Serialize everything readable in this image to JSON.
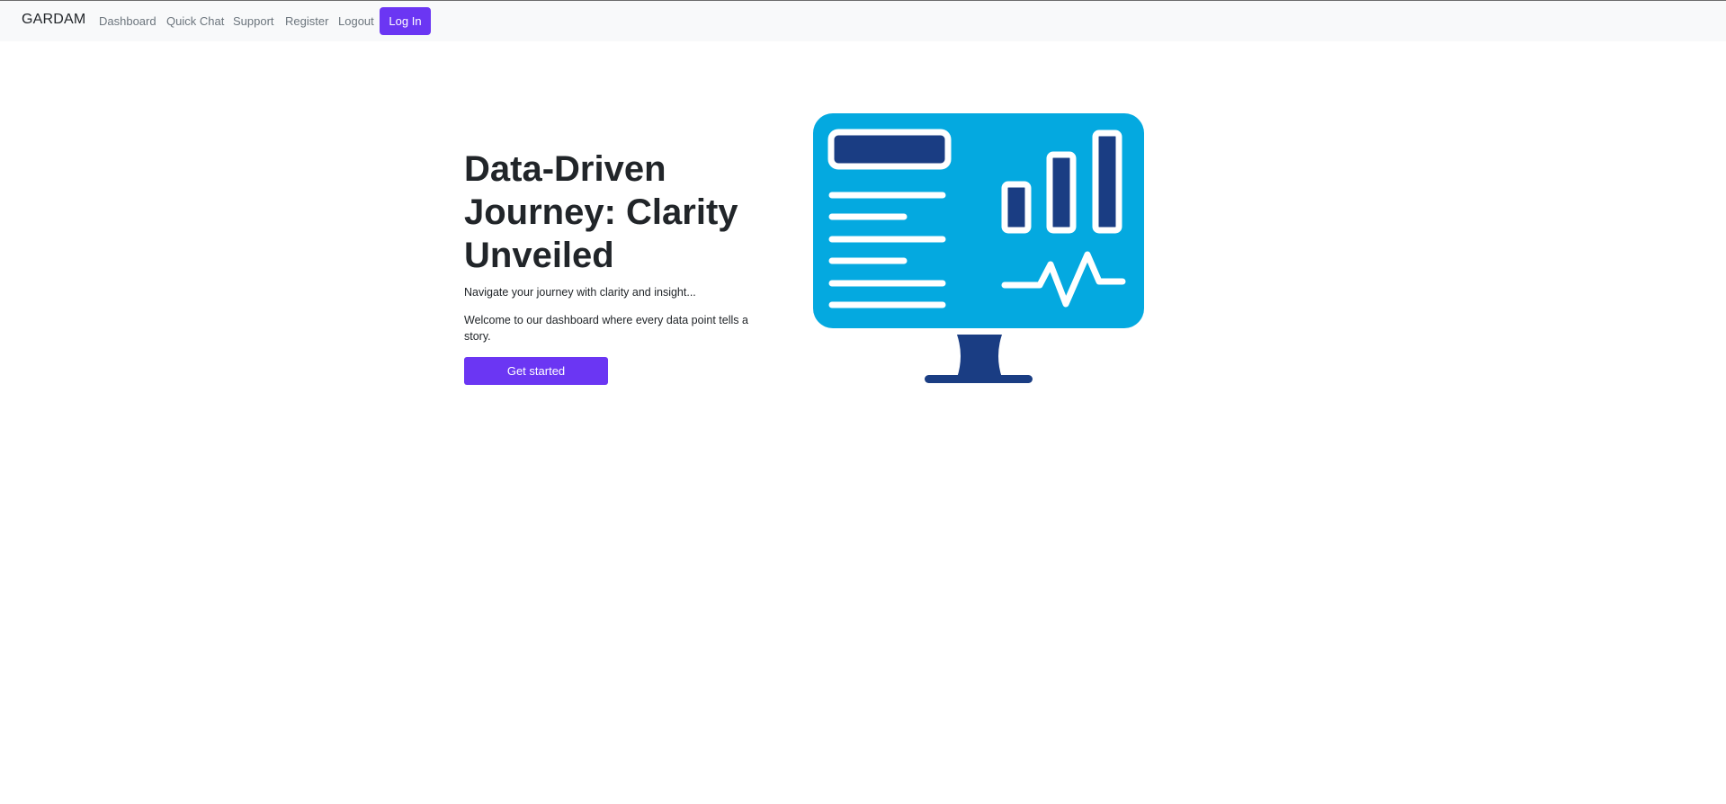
{
  "navbar": {
    "brand": "GARDAM",
    "links": [
      {
        "label": "Dashboard"
      },
      {
        "label": "Quick Chat"
      },
      {
        "label": "Support"
      },
      {
        "label": "Register"
      },
      {
        "label": "Logout"
      }
    ],
    "login_label": "Log In"
  },
  "hero": {
    "title": "Data-Driven Journey: Clarity Unveiled",
    "subtitle": "Navigate your journey with clarity and insight...",
    "description": "Welcome to our dashboard where every data point tells a story.",
    "cta_label": "Get started",
    "illustration_icon": "monitor-analytics-icon"
  },
  "colors": {
    "accent": "#6b36f3",
    "screen": "#04a9e0",
    "dark_blue": "#1a3d83",
    "navbar_bg": "#f8f9fa"
  }
}
